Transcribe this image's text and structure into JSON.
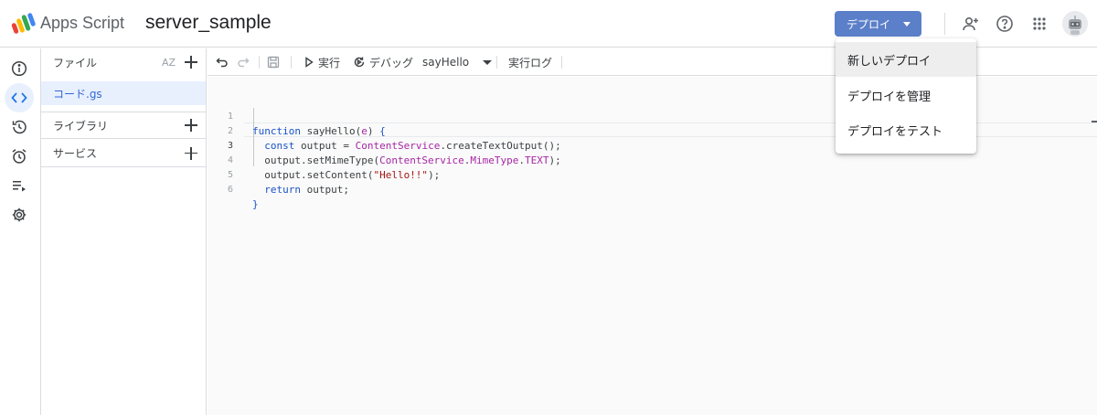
{
  "header": {
    "app_name": "Apps Script",
    "project_name": "server_sample",
    "deploy_label": "デプロイ"
  },
  "rail": {
    "items": [
      {
        "icon": "info-icon"
      },
      {
        "icon": "code-icon",
        "active": true
      },
      {
        "icon": "history-icon"
      },
      {
        "icon": "alarm-icon"
      },
      {
        "icon": "executions-icon"
      },
      {
        "icon": "gear-icon"
      }
    ]
  },
  "files_panel": {
    "files_label": "ファイル",
    "sort_label": "AZ",
    "file_name": "コード.gs",
    "libraries_label": "ライブラリ",
    "services_label": "サービス"
  },
  "toolbar": {
    "run_label": "実行",
    "debug_label": "デバッグ",
    "function_name": "sayHello",
    "log_label": "実行ログ"
  },
  "editor": {
    "line_numbers": [
      "1",
      "2",
      "3",
      "4",
      "5",
      "6"
    ],
    "current_line": 3
  },
  "deploy_menu": {
    "items": [
      "新しいデプロイ",
      "デプロイを管理",
      "デプロイをテスト"
    ]
  },
  "colors": {
    "accent": "#5b7fc9",
    "selected_bg": "#e8f0fe",
    "keyword": "#1a53c7",
    "class": "#a626a4",
    "string": "#a31515"
  }
}
